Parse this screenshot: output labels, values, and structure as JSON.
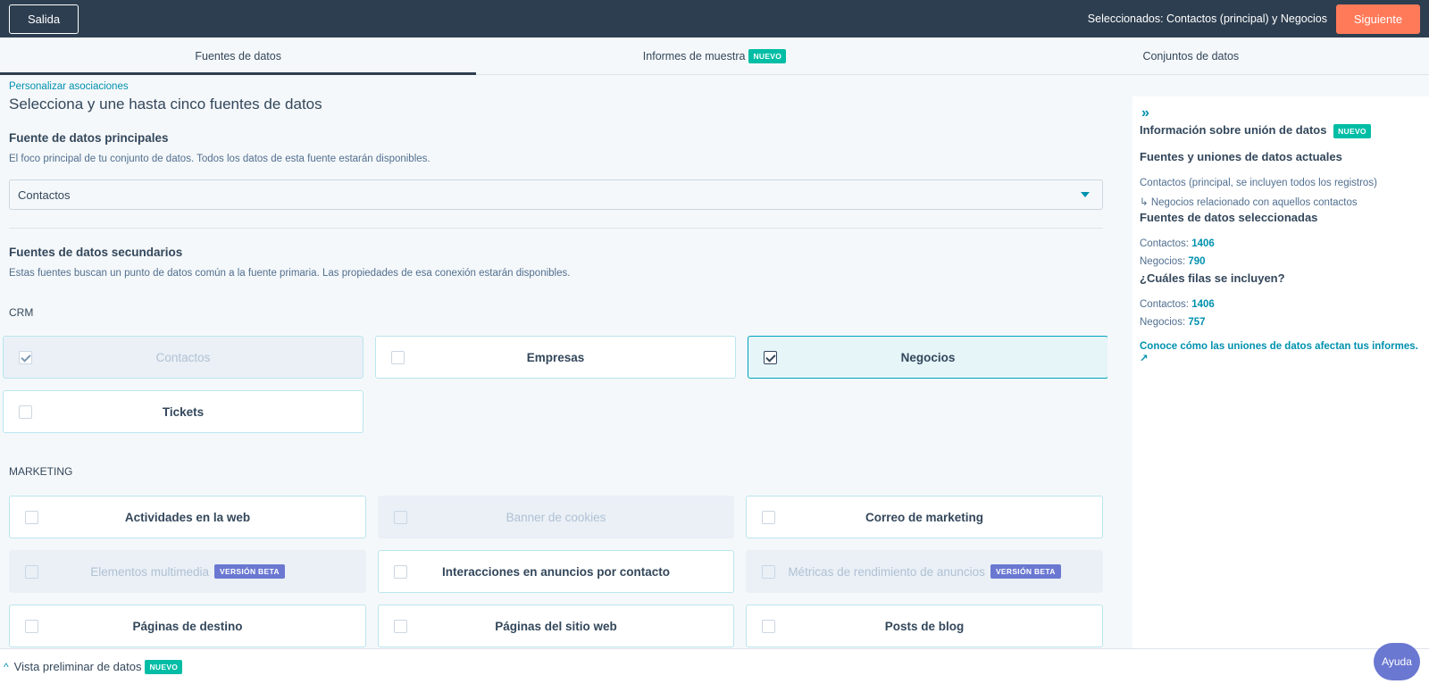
{
  "topbar": {
    "exit_label": "Salida",
    "selected_text": "Seleccionados: Contactos (principal) y Negocios",
    "next_label": "Siguiente"
  },
  "tabs": [
    {
      "label": "Fuentes de datos"
    },
    {
      "label": "Informes de muestra",
      "badge": "NUEVO"
    },
    {
      "label": "Conjuntos de datos"
    }
  ],
  "main": {
    "customize_link": "Personalizar asociaciones",
    "title": "Selecciona y une hasta cinco fuentes de datos",
    "primary": {
      "heading": "Fuente de datos principales",
      "description": "El foco principal de tu conjunto de datos. Todos los datos de esta fuente estarán disponibles.",
      "selected": "Contactos"
    },
    "secondary": {
      "heading": "Fuentes de datos secundarios",
      "description": "Estas fuentes buscan un punto de datos común a la fuente primaria. Las propiedades de esa conexión estarán disponibles."
    },
    "crm_label": "CRM",
    "crm_items": [
      {
        "label": "Contactos",
        "state": "checked-disabled"
      },
      {
        "label": "Empresas",
        "state": "unchecked"
      },
      {
        "label": "Negocios",
        "state": "checked"
      },
      {
        "label": "Tickets",
        "state": "unchecked"
      }
    ],
    "marketing_label": "MARKETING",
    "marketing_items": [
      {
        "label": "Actividades en la web",
        "state": "unchecked"
      },
      {
        "label": "Banner de cookies",
        "state": "disabled"
      },
      {
        "label": "Correo de marketing",
        "state": "unchecked"
      },
      {
        "label": "Elementos multimedia",
        "state": "disabled",
        "badge": "VERSIÓN BETA"
      },
      {
        "label": "Interacciones en anuncios por contacto",
        "state": "unchecked"
      },
      {
        "label": "Métricas de rendimiento de anuncios",
        "state": "disabled",
        "badge": "VERSIÓN BETA"
      },
      {
        "label": "Páginas de destino",
        "state": "unchecked"
      },
      {
        "label": "Páginas del sitio web",
        "state": "unchecked"
      },
      {
        "label": "Posts de blog",
        "state": "unchecked"
      }
    ]
  },
  "panel": {
    "title": "Información sobre unión de datos",
    "title_badge": "NUEVO",
    "current_heading": "Fuentes y uniones de datos actuales",
    "current_line1": "Contactos (principal, se incluyen todos los registros)",
    "current_line2": "Negocios relacionado con aquellos contactos",
    "selected_heading": "Fuentes de datos seleccionadas",
    "selected_contacts_label": "Contactos:",
    "selected_contacts_value": "1406",
    "selected_deals_label": "Negocios:",
    "selected_deals_value": "790",
    "rows_heading": "¿Cuáles filas se incluyen?",
    "rows_contacts_label": "Contactos:",
    "rows_contacts_value": "1406",
    "rows_deals_label": "Negocios:",
    "rows_deals_value": "757",
    "learn_link": "Conoce cómo las uniones de datos afectan tus informes."
  },
  "bottombar": {
    "label": "Vista preliminar de datos",
    "badge": "NUEVO"
  },
  "help_label": "Ayuda",
  "colors": {
    "topbar": "#2d3e50",
    "accent": "#ff7a59",
    "link": "#0091ae",
    "new_badge": "#00bda5",
    "beta_badge": "#6a78d1"
  }
}
